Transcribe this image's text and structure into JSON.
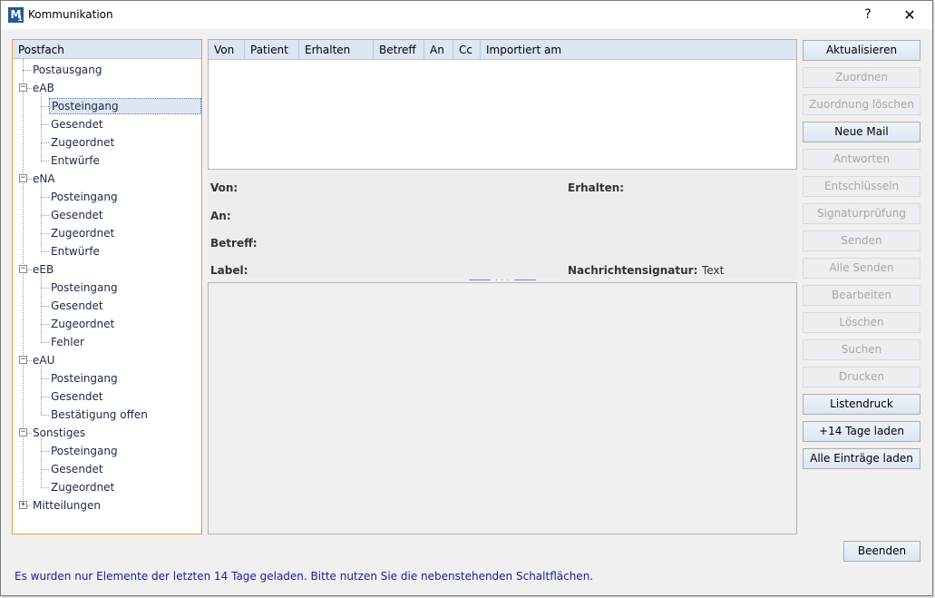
{
  "window": {
    "title": "Kommunikation",
    "icon_letters": "M",
    "icon_small": "1",
    "help": "?",
    "close": "✕"
  },
  "tree": {
    "header": "Postfach",
    "expander_open": "−",
    "expander_closed": "+",
    "nodes": [
      {
        "label": "Postausgang",
        "level": 0,
        "expander": "none"
      },
      {
        "label": "eAB",
        "level": 0,
        "expander": "open"
      },
      {
        "label": "Posteingang",
        "level": 1,
        "selected": true
      },
      {
        "label": "Gesendet",
        "level": 1
      },
      {
        "label": "Zugeordnet",
        "level": 1
      },
      {
        "label": "Entwürfe",
        "level": 1
      },
      {
        "label": "eNA",
        "level": 0,
        "expander": "open"
      },
      {
        "label": "Posteingang",
        "level": 1
      },
      {
        "label": "Gesendet",
        "level": 1
      },
      {
        "label": "Zugeordnet",
        "level": 1
      },
      {
        "label": "Entwürfe",
        "level": 1
      },
      {
        "label": "eEB",
        "level": 0,
        "expander": "open"
      },
      {
        "label": "Posteingang",
        "level": 1
      },
      {
        "label": "Gesendet",
        "level": 1
      },
      {
        "label": "Zugeordnet",
        "level": 1
      },
      {
        "label": "Fehler",
        "level": 1
      },
      {
        "label": "eAU",
        "level": 0,
        "expander": "open"
      },
      {
        "label": "Posteingang",
        "level": 1
      },
      {
        "label": "Gesendet",
        "level": 1
      },
      {
        "label": "Bestätigung offen",
        "level": 1
      },
      {
        "label": "Sonstiges",
        "level": 0,
        "expander": "open"
      },
      {
        "label": "Posteingang",
        "level": 1
      },
      {
        "label": "Gesendet",
        "level": 1
      },
      {
        "label": "Zugeordnet",
        "level": 1
      },
      {
        "label": "Mitteilungen",
        "level": 0,
        "expander": "closed"
      }
    ]
  },
  "grid": {
    "columns": [
      "Von",
      "Patient",
      "Erhalten",
      "Betreff",
      "An",
      "Cc",
      "Importiert am"
    ]
  },
  "details": {
    "von": "Von:",
    "an": "An:",
    "betreff": "Betreff:",
    "label": "Label:",
    "erhalten": "Erhalten:",
    "signatur": "Nachrichtensignatur:",
    "signatur_value": "Text"
  },
  "buttons": [
    {
      "label": "Aktualisieren",
      "enabled": true
    },
    {
      "label": "Zuordnen",
      "enabled": false
    },
    {
      "label": "Zuordnung löschen",
      "enabled": false
    },
    {
      "label": "Neue Mail",
      "enabled": true
    },
    {
      "label": "Antworten",
      "enabled": false
    },
    {
      "label": "Entschlüsseln",
      "enabled": false
    },
    {
      "label": "Signaturprüfung",
      "enabled": false
    },
    {
      "label": "Senden",
      "enabled": false
    },
    {
      "label": "Alle Senden",
      "enabled": false
    },
    {
      "label": "Bearbeiten",
      "enabled": false
    },
    {
      "label": "Löschen",
      "enabled": false
    },
    {
      "label": "Suchen",
      "enabled": false
    },
    {
      "label": "Drucken",
      "enabled": false
    },
    {
      "label": "Listendruck",
      "enabled": true
    },
    {
      "label": "+14 Tage laden",
      "enabled": true
    },
    {
      "label": "Alle Einträge laden",
      "enabled": true
    }
  ],
  "beenden": "Beenden",
  "status": "Es wurden nur Elemente der letzten 14 Tage geladen. Bitte nutzen Sie die nebenstehenden Schaltflächen."
}
